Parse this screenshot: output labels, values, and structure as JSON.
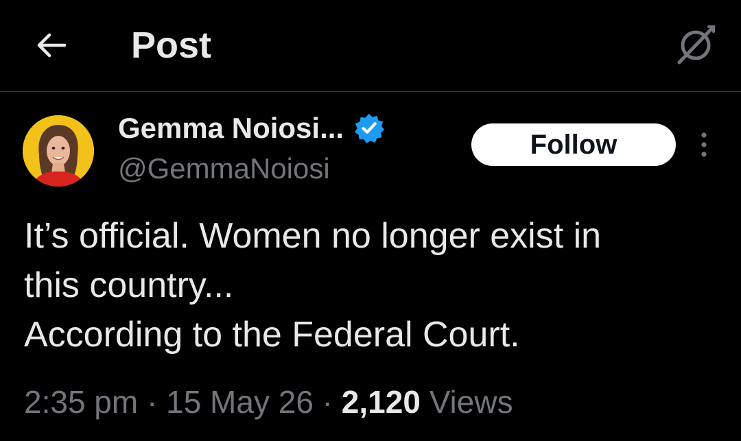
{
  "header": {
    "title": "Post",
    "back_icon": "arrow-left-icon",
    "grok_icon": "grok-icon"
  },
  "author": {
    "display_name": "Gemma Noiosi...",
    "handle": "@GemmaNoiosi",
    "verified": true,
    "verified_color": "#1d9bf0",
    "avatar_bg": "#f2c21b"
  },
  "actions": {
    "follow_label": "Follow",
    "more_icon": "more-vertical-icon"
  },
  "post": {
    "lines": [
      "It’s official. Women no longer exist in",
      "this country...",
      "According to the Federal Court."
    ]
  },
  "meta": {
    "time": "2:35 pm",
    "separator": " · ",
    "date": "15 May 26",
    "views_count": "2,120",
    "views_label": " Views"
  },
  "colors": {
    "background": "#000000",
    "text_primary": "#e7e9ea",
    "text_secondary": "#71767b",
    "divider": "#2f3336"
  }
}
